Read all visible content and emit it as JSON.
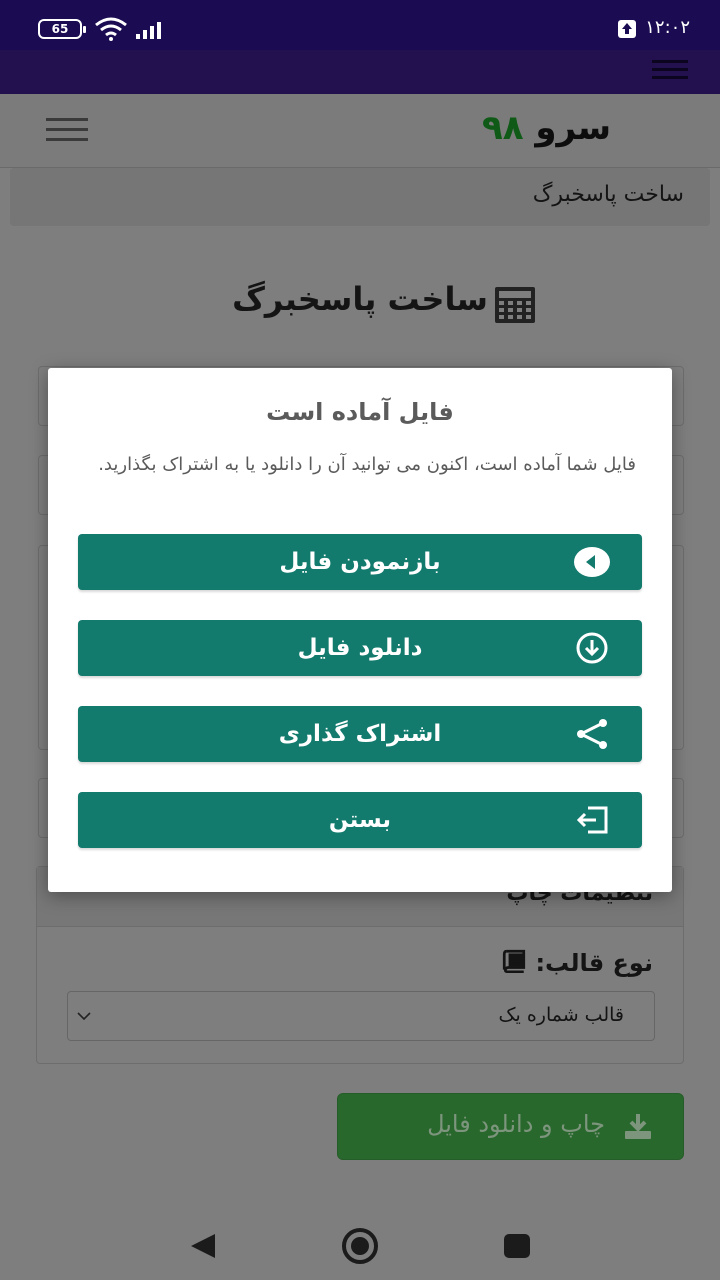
{
  "status": {
    "battery": "65",
    "time": "۱۲:۰۲"
  },
  "header": {
    "logo_word": "سرو",
    "logo_number": "۹۸"
  },
  "breadcrumb": "ساخت پاسخبرگ",
  "page_title": "ساخت پاسخبرگ",
  "settings": {
    "title": "تنظیمات چاپ",
    "template_type_label": "نوع قالب:",
    "template_selected": "قالب شماره یک"
  },
  "print_button": "چاپ و دانلود فایل",
  "modal": {
    "title": "فایل آماده است",
    "message": "فایل شما آماده است، اکنون می توانید آن را دانلود یا به اشتراک بگذارید.",
    "buttons": {
      "open": "بازنمودن فایل",
      "download": "دانلود فایل",
      "share": "اشتراک گذاری",
      "close": "بستن"
    }
  },
  "colors": {
    "primary": "#137b6e",
    "statusbar": "#1b0b52",
    "print_button": "#29682d"
  }
}
